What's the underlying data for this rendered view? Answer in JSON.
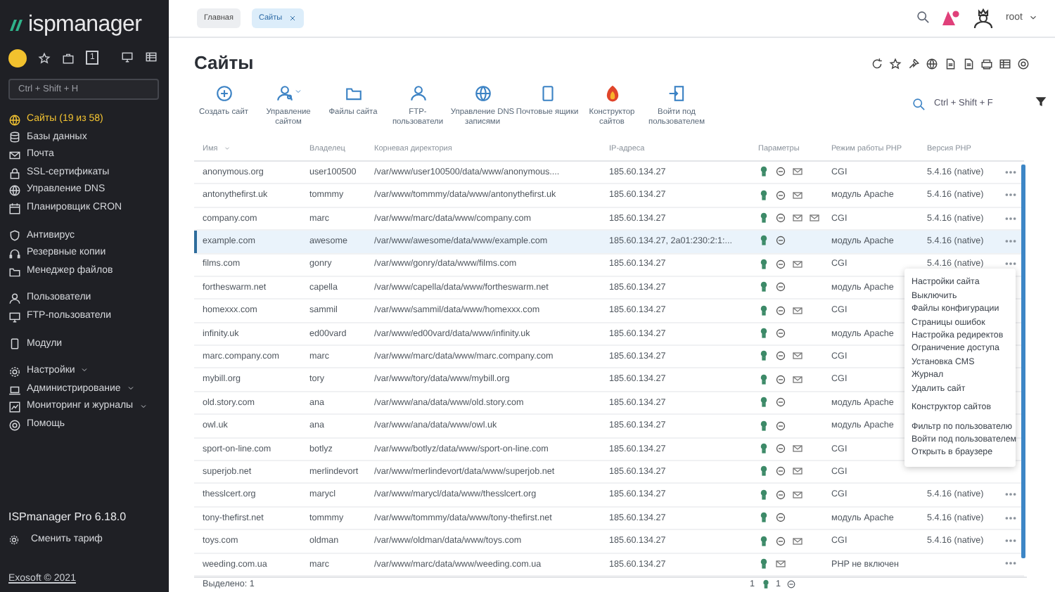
{
  "sidebar": {
    "logo": "ispmanager",
    "quick_badge": "1",
    "search": {
      "placeholder": "Ctrl + Shift + H"
    },
    "groups": [
      [
        {
          "label": "Сайты (19 из 58)",
          "selected": true,
          "expandable": false
        },
        {
          "label": "Базы данных",
          "selected": false,
          "expandable": false
        },
        {
          "label": "Почта",
          "selected": false,
          "expandable": false
        },
        {
          "label": "SSL-сертификаты",
          "selected": false,
          "expandable": false
        },
        {
          "label": "Управление DNS",
          "selected": false,
          "expandable": false
        },
        {
          "label": "Планировщик CRON",
          "selected": false,
          "expandable": false
        }
      ],
      [
        {
          "label": "Антивирус",
          "selected": false,
          "expandable": false
        },
        {
          "label": "Резервные копии",
          "selected": false,
          "expandable": false
        },
        {
          "label": "Менеджер файлов",
          "selected": false,
          "expandable": false
        }
      ],
      [
        {
          "label": "Пользователи",
          "selected": false,
          "expandable": false
        },
        {
          "label": "FTP-пользователи",
          "selected": false,
          "expandable": false
        }
      ],
      [
        {
          "label": "Модули",
          "selected": false,
          "expandable": false
        }
      ],
      [
        {
          "label": "Настройки",
          "selected": false,
          "expandable": true
        },
        {
          "label": "Администрирование",
          "selected": false,
          "expandable": true
        },
        {
          "label": "Мониторинг и журналы",
          "selected": false,
          "expandable": true
        },
        {
          "label": "Помощь",
          "selected": false,
          "expandable": false
        }
      ]
    ],
    "version": "ISPmanager Pro 6.18.0",
    "change_plan": "Сменить тариф",
    "copyright": "Exosoft © 2021"
  },
  "tabs": [
    {
      "label": "Главная",
      "selected": false,
      "closable": false
    },
    {
      "label": "Сайты",
      "selected": true,
      "closable": true
    }
  ],
  "user": {
    "name": "root",
    "alerts": true
  },
  "page_title": "Сайты",
  "toolbar": [
    {
      "label": "Создать сайт",
      "dropdown": false
    },
    {
      "label": "Управление сайтом",
      "dropdown": true
    },
    {
      "label": "Файлы сайта",
      "dropdown": false
    },
    {
      "label": "FTP-пользователи",
      "dropdown": false
    },
    {
      "label": "Управление DNS записями",
      "dropdown": false
    },
    {
      "label": "Почтовые ящики",
      "dropdown": false
    },
    {
      "label": "Конструктор сайтов",
      "dropdown": false
    },
    {
      "label": "Войти под пользователем",
      "dropdown": false
    }
  ],
  "table_search": {
    "placeholder": "Ctrl + Shift + F"
  },
  "table": {
    "columns": [
      "Имя",
      "Владелец",
      "Корневая директория",
      "IP-адреса",
      "Параметры",
      "Режим работы PHP",
      "Версия PHP"
    ],
    "rows": [
      {
        "name": "anonymous.org",
        "owner": "user100500",
        "dir": "/var/www/user100500/data/www/anonymous....",
        "ip": "185.60.134.27",
        "params": [
          {
            "kind": "bulb"
          },
          {
            "kind": "circle"
          },
          {
            "kind": "mail"
          }
        ],
        "php_mode": "CGI",
        "php_version": "5.4.16 (native)",
        "menu_button": true,
        "selected": false
      },
      {
        "name": "antonythefirst.uk",
        "owner": "tommmy",
        "dir": "/var/www/tommmy/data/www/antonythefirst.uk",
        "ip": "185.60.134.27",
        "params": [
          {
            "kind": "bulb"
          },
          {
            "kind": "circle"
          },
          {
            "kind": "mail"
          }
        ],
        "php_mode": "модуль Apache",
        "php_version": "5.4.16 (native)",
        "menu_button": true,
        "selected": false
      },
      {
        "name": "company.com",
        "owner": "marc",
        "dir": "/var/www/marc/data/www/company.com",
        "ip": "185.60.134.27",
        "params": [
          {
            "kind": "bulb"
          },
          {
            "kind": "circle"
          },
          {
            "kind": "mail"
          },
          {
            "kind": "mail"
          }
        ],
        "php_mode": "CGI",
        "php_version": "5.4.16 (native)",
        "menu_button": true,
        "selected": false
      },
      {
        "name": "example.com",
        "owner": "awesome",
        "dir": "/var/www/awesome/data/www/example.com",
        "ip": "185.60.134.27, 2a01:230:2:1:...",
        "params": [
          {
            "kind": "bulb"
          },
          {
            "kind": "circle"
          }
        ],
        "php_mode": "модуль Apache",
        "php_version": "5.4.16 (native)",
        "menu_button": true,
        "selected": true
      },
      {
        "name": "films.com",
        "owner": "gonry",
        "dir": "/var/www/gonry/data/www/films.com",
        "ip": "185.60.134.27",
        "params": [
          {
            "kind": "bulb"
          },
          {
            "kind": "circle"
          },
          {
            "kind": "mail"
          }
        ],
        "php_mode": "CGI",
        "php_version": "5.4.16 (native)",
        "menu_button": true,
        "selected": false
      },
      {
        "name": "fortheswarm.net",
        "owner": "capella",
        "dir": "/var/www/capella/data/www/fortheswarm.net",
        "ip": "185.60.134.27",
        "params": [
          {
            "kind": "bulb"
          },
          {
            "kind": "circle"
          }
        ],
        "php_mode": "модуль Apache",
        "menu_button": false,
        "selected": false
      },
      {
        "name": "homexxx.com",
        "owner": "sammil",
        "dir": "/var/www/sammil/data/www/homexxx.com",
        "ip": "185.60.134.27",
        "params": [
          {
            "kind": "bulb"
          },
          {
            "kind": "circle"
          },
          {
            "kind": "mail"
          }
        ],
        "php_mode": "CGI",
        "menu_button": false,
        "selected": false
      },
      {
        "name": "infinity.uk",
        "owner": "ed00vard",
        "dir": "/var/www/ed00vard/data/www/infinity.uk",
        "ip": "185.60.134.27",
        "params": [
          {
            "kind": "bulb"
          },
          {
            "kind": "circle"
          }
        ],
        "php_mode": "модуль Apache",
        "menu_button": false,
        "selected": false
      },
      {
        "name": "marc.company.com",
        "owner": "marc",
        "dir": "/var/www/marc/data/www/marc.company.com",
        "ip": "185.60.134.27",
        "params": [
          {
            "kind": "bulb"
          },
          {
            "kind": "circle"
          },
          {
            "kind": "mail"
          }
        ],
        "php_mode": "CGI",
        "menu_button": false,
        "selected": false
      },
      {
        "name": "mybill.org",
        "owner": "tory",
        "dir": "/var/www/tory/data/www/mybill.org",
        "ip": "185.60.134.27",
        "params": [
          {
            "kind": "bulb"
          },
          {
            "kind": "circle"
          },
          {
            "kind": "mail"
          }
        ],
        "php_mode": "CGI",
        "menu_button": false,
        "selected": false
      },
      {
        "name": "old.story.com",
        "owner": "ana",
        "dir": "/var/www/ana/data/www/old.story.com",
        "ip": "185.60.134.27",
        "params": [
          {
            "kind": "bulb"
          },
          {
            "kind": "circle"
          }
        ],
        "php_mode": "модуль Apache",
        "menu_button": false,
        "selected": false
      },
      {
        "name": "owl.uk",
        "owner": "ana",
        "dir": "/var/www/ana/data/www/owl.uk",
        "ip": "185.60.134.27",
        "params": [
          {
            "kind": "bulb"
          },
          {
            "kind": "circle"
          }
        ],
        "php_mode": "модуль Apache",
        "menu_button": false,
        "selected": false
      },
      {
        "name": "sport-on-line.com",
        "owner": "botlyz",
        "dir": "/var/www/botlyz/data/www/sport-on-line.com",
        "ip": "185.60.134.27",
        "params": [
          {
            "kind": "bulb"
          },
          {
            "kind": "circle"
          },
          {
            "kind": "mail"
          }
        ],
        "php_mode": "CGI",
        "menu_button": false,
        "selected": false
      },
      {
        "name": "superjob.net",
        "owner": "merlindevort",
        "dir": "/var/www/merlindevort/data/www/superjob.net",
        "ip": "185.60.134.27",
        "params": [
          {
            "kind": "bulb"
          },
          {
            "kind": "circle"
          },
          {
            "kind": "mail"
          }
        ],
        "php_mode": "CGI",
        "menu_button": false,
        "selected": false
      },
      {
        "name": "thesslcert.org",
        "owner": "marycl",
        "dir": "/var/www/marycl/data/www/thesslcert.org",
        "ip": "185.60.134.27",
        "params": [
          {
            "kind": "bulb"
          },
          {
            "kind": "circle"
          },
          {
            "kind": "mail"
          }
        ],
        "php_mode": "CGI",
        "php_version": "5.4.16 (native)",
        "menu_button": true,
        "selected": false
      },
      {
        "name": "tony-thefirst.net",
        "owner": "tommmy",
        "dir": "/var/www/tommmy/data/www/tony-thefirst.net",
        "ip": "185.60.134.27",
        "params": [
          {
            "kind": "bulb"
          },
          {
            "kind": "circle"
          }
        ],
        "php_mode": "модуль Apache",
        "php_version": "5.4.16 (native)",
        "menu_button": true,
        "selected": false
      },
      {
        "name": "toys.com",
        "owner": "oldman",
        "dir": "/var/www/oldman/data/www/toys.com",
        "ip": "185.60.134.27",
        "params": [
          {
            "kind": "bulb"
          },
          {
            "kind": "circle"
          },
          {
            "kind": "mail"
          }
        ],
        "php_mode": "CGI",
        "php_version": "5.4.16 (native)",
        "menu_button": true,
        "selected": false
      },
      {
        "name": "weeding.com.ua",
        "owner": "marc",
        "dir": "/var/www/marc/data/www/weeding.com.ua",
        "ip": "185.60.134.27",
        "params": [
          {
            "kind": "bulb"
          },
          {
            "kind": "mail"
          }
        ],
        "php_mode": "PHP не включен",
        "menu_button": true,
        "selected": false
      }
    ],
    "footer": {
      "selected": "Выделено: 1",
      "bulb_count": "1",
      "circle_count": "1"
    }
  },
  "context_menu": [
    [
      "Настройки сайта",
      "Выключить",
      "Файлы конфигурации",
      "Страницы ошибок",
      "Настройка редиректов",
      "Ограничение доступа",
      "Установка CMS",
      "Журнал",
      "Удалить сайт"
    ],
    [
      "Конструктор сайтов"
    ],
    [
      "Фильтр по пользователю",
      "Войти под пользователем",
      "Открыть в браузере"
    ]
  ]
}
